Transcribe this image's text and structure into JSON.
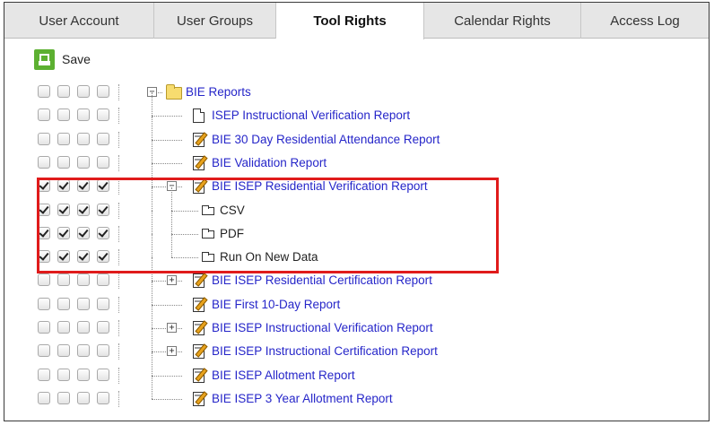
{
  "tabs": [
    {
      "label": "User Account",
      "active": false
    },
    {
      "label": "User Groups",
      "active": false
    },
    {
      "label": "Tool Rights",
      "active": true
    },
    {
      "label": "Calendar Rights",
      "active": false
    },
    {
      "label": "Access Log",
      "active": false
    }
  ],
  "toolbar": {
    "save_label": "Save",
    "save_icon": "save-icon"
  },
  "accent": "#5cb031",
  "link_color": "#2626c9",
  "highlight_color": "#e01b1b",
  "tree": [
    {
      "label": "BIE Reports",
      "icon": "folder-icon",
      "expander": "−",
      "checked": [
        false,
        false,
        false,
        false
      ],
      "level": 0,
      "link": true
    },
    {
      "label": "ISEP Instructional Verification Report",
      "icon": "document-icon",
      "checked": [
        false,
        false,
        false,
        false
      ],
      "level": 1,
      "link": true
    },
    {
      "label": "BIE 30 Day Residential Attendance Report",
      "icon": "edit-document-icon",
      "checked": [
        false,
        false,
        false,
        false
      ],
      "level": 1,
      "link": true
    },
    {
      "label": "BIE Validation Report",
      "icon": "edit-document-icon",
      "checked": [
        false,
        false,
        false,
        false
      ],
      "level": 1,
      "link": true
    },
    {
      "label": "BIE ISEP Residential Verification Report",
      "icon": "edit-document-icon",
      "expander": "−",
      "checked": [
        true,
        true,
        true,
        true
      ],
      "level": 1,
      "link": true
    },
    {
      "label": "CSV",
      "icon": "sub-item-icon",
      "checked": [
        true,
        true,
        true,
        true
      ],
      "level": 2,
      "link": false
    },
    {
      "label": "PDF",
      "icon": "sub-item-icon",
      "checked": [
        true,
        true,
        true,
        true
      ],
      "level": 2,
      "link": false
    },
    {
      "label": "Run On New Data",
      "icon": "sub-item-icon",
      "checked": [
        true,
        true,
        true,
        true
      ],
      "level": 2,
      "link": false
    },
    {
      "label": "BIE ISEP Residential Certification Report",
      "icon": "edit-document-icon",
      "expander": "+",
      "checked": [
        false,
        false,
        false,
        false
      ],
      "level": 1,
      "link": true
    },
    {
      "label": "BIE First 10-Day Report",
      "icon": "edit-document-icon",
      "checked": [
        false,
        false,
        false,
        false
      ],
      "level": 1,
      "link": true
    },
    {
      "label": "BIE ISEP Instructional Verification Report",
      "icon": "edit-document-icon",
      "expander": "+",
      "checked": [
        false,
        false,
        false,
        false
      ],
      "level": 1,
      "link": true
    },
    {
      "label": "BIE ISEP Instructional Certification Report",
      "icon": "edit-document-icon",
      "expander": "+",
      "checked": [
        false,
        false,
        false,
        false
      ],
      "level": 1,
      "link": true
    },
    {
      "label": "BIE ISEP Allotment Report",
      "icon": "edit-document-icon",
      "checked": [
        false,
        false,
        false,
        false
      ],
      "level": 1,
      "link": true
    },
    {
      "label": "BIE ISEP 3 Year Allotment Report",
      "icon": "edit-document-icon",
      "checked": [
        false,
        false,
        false,
        false
      ],
      "level": 1,
      "link": true
    }
  ]
}
